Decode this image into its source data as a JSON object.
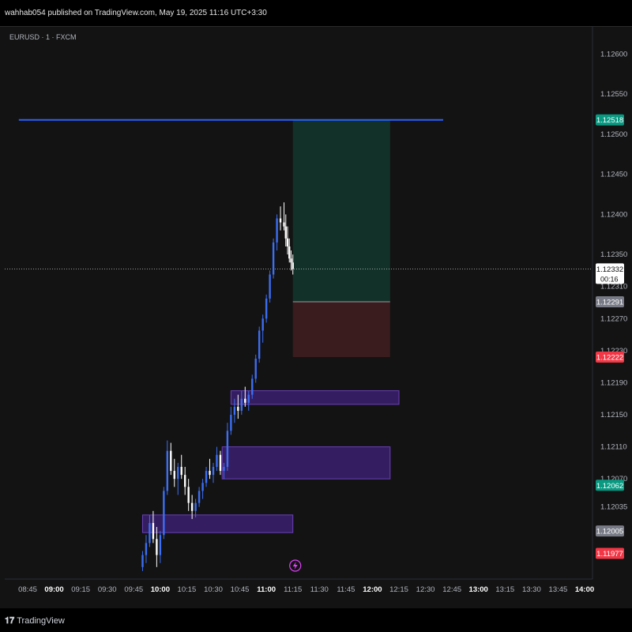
{
  "header": {
    "publish_line": "wahhab054 published on TradingView.com, May 19, 2025 11:16 UTC+3:30"
  },
  "symbol_label": "EURUSD · 1 · FXCM",
  "footer": {
    "brand": "TradingView",
    "logo_glyph": "𝟏𝟕"
  },
  "colors": {
    "background": "#131313",
    "up": "#3d6ef3",
    "down": "#ffffff",
    "blue_line": "#2962ff",
    "profit_zone": "#123229",
    "loss_zone": "#3a1c1f",
    "order_block": "#3b2170",
    "order_block_border": "#6b3fb8"
  },
  "chart_data": {
    "type": "candlestick",
    "symbol": "EURUSD",
    "interval": "1",
    "source": "FXCM",
    "x_ticks": [
      "08:45",
      "09:00",
      "09:15",
      "09:30",
      "09:45",
      "10:00",
      "10:15",
      "10:30",
      "10:45",
      "11:00",
      "11:15",
      "11:30",
      "11:45",
      "12:00",
      "12:15",
      "12:30",
      "12:45",
      "13:00",
      "13:15",
      "13:30",
      "13:45",
      "14:00"
    ],
    "bold_x_ticks": [
      "09:00",
      "10:00",
      "11:00",
      "12:00",
      "13:00",
      "14:00"
    ],
    "y_ticks": [
      "1.12600",
      "1.12550",
      "1.12500",
      "1.12450",
      "1.12400",
      "1.12350",
      "1.12310",
      "1.12270",
      "1.12230",
      "1.12190",
      "1.12150",
      "1.12110",
      "1.12070",
      "1.12035"
    ],
    "ylim": [
      1.11945,
      1.12635
    ],
    "price_labels": [
      {
        "value": "1.12518",
        "bg": "#089981",
        "fg": "#ffffff"
      },
      {
        "value": "1.12332",
        "bg": "#ffffff",
        "fg": "#131313",
        "countdown": "00:16"
      },
      {
        "value": "1.12291",
        "bg": "#787b86",
        "fg": "#ffffff"
      },
      {
        "value": "1.12222",
        "bg": "#f23645",
        "fg": "#ffffff"
      },
      {
        "value": "1.12062",
        "bg": "#089981",
        "fg": "#ffffff"
      },
      {
        "value": "1.12005",
        "bg": "#787b86",
        "fg": "#ffffff"
      },
      {
        "value": "1.11977",
        "bg": "#f23645",
        "fg": "#ffffff"
      }
    ],
    "horizontal_line": {
      "price": 1.12518,
      "from": "08:40",
      "to": "12:40"
    },
    "current_price_line": 1.12332,
    "long_position": {
      "start": "11:15",
      "end": "12:10",
      "target": 1.12518,
      "entry": 1.12291,
      "stop": 1.12222
    },
    "order_blocks": [
      {
        "start": "10:40",
        "end": "12:15",
        "top": 1.1218,
        "bottom": 1.12163
      },
      {
        "start": "10:35",
        "end": "12:10",
        "top": 1.1211,
        "bottom": 1.1207
      },
      {
        "start": "09:50",
        "end": "11:15",
        "top": 1.12025,
        "bottom": 1.12003
      }
    ],
    "ohlc": [
      [
        "09:50",
        1.1196,
        1.1198,
        1.11955,
        1.11975
      ],
      [
        "09:52",
        1.11975,
        1.12,
        1.11965,
        1.1199
      ],
      [
        "09:54",
        1.1199,
        1.12025,
        1.11985,
        1.12015
      ],
      [
        "09:56",
        1.12015,
        1.1203,
        1.1199,
        1.11995
      ],
      [
        "09:58",
        1.11995,
        1.1201,
        1.1196,
        1.11975
      ],
      [
        "10:00",
        1.11975,
        1.12005,
        1.11965,
        1.12
      ],
      [
        "10:02",
        1.12,
        1.1206,
        1.11995,
        1.12055
      ],
      [
        "10:04",
        1.12055,
        1.12118,
        1.1205,
        1.12105
      ],
      [
        "10:06",
        1.12105,
        1.12115,
        1.12075,
        1.1208
      ],
      [
        "10:08",
        1.1208,
        1.12095,
        1.1206,
        1.1207
      ],
      [
        "10:10",
        1.1207,
        1.1209,
        1.1205,
        1.12085
      ],
      [
        "10:12",
        1.12085,
        1.121,
        1.1207,
        1.12075
      ],
      [
        "10:14",
        1.12075,
        1.12085,
        1.1205,
        1.1206
      ],
      [
        "10:16",
        1.1206,
        1.1207,
        1.1203,
        1.1204
      ],
      [
        "10:18",
        1.1204,
        1.1205,
        1.1202,
        1.1203
      ],
      [
        "10:20",
        1.1203,
        1.12045,
        1.12022,
        1.1204
      ],
      [
        "10:22",
        1.1204,
        1.1206,
        1.12035,
        1.12055
      ],
      [
        "10:24",
        1.12055,
        1.1207,
        1.12045,
        1.12065
      ],
      [
        "10:26",
        1.12065,
        1.12085,
        1.1206,
        1.1208
      ],
      [
        "10:28",
        1.1208,
        1.12095,
        1.1207,
        1.12075
      ],
      [
        "10:30",
        1.12075,
        1.1209,
        1.12065,
        1.12085
      ],
      [
        "10:32",
        1.12085,
        1.1211,
        1.1208,
        1.121
      ],
      [
        "10:34",
        1.121,
        1.12105,
        1.12075,
        1.1208
      ],
      [
        "10:36",
        1.1208,
        1.1209,
        1.1207,
        1.12085
      ],
      [
        "10:38",
        1.12085,
        1.1214,
        1.1208,
        1.1213
      ],
      [
        "10:40",
        1.1213,
        1.1216,
        1.12125,
        1.1215
      ],
      [
        "10:42",
        1.1215,
        1.1217,
        1.1214,
        1.1216
      ],
      [
        "10:44",
        1.1216,
        1.12175,
        1.12145,
        1.12155
      ],
      [
        "10:46",
        1.12155,
        1.1218,
        1.1215,
        1.1217
      ],
      [
        "10:48",
        1.1217,
        1.12185,
        1.1216,
        1.12165
      ],
      [
        "10:50",
        1.12165,
        1.1218,
        1.12155,
        1.12175
      ],
      [
        "10:52",
        1.12175,
        1.122,
        1.1217,
        1.12195
      ],
      [
        "10:54",
        1.12195,
        1.12225,
        1.1219,
        1.1222
      ],
      [
        "10:56",
        1.1222,
        1.1226,
        1.12215,
        1.12255
      ],
      [
        "10:58",
        1.12255,
        1.12275,
        1.1224,
        1.1227
      ],
      [
        "11:00",
        1.1227,
        1.123,
        1.12265,
        1.12295
      ],
      [
        "11:02",
        1.12295,
        1.1233,
        1.1229,
        1.12325
      ],
      [
        "11:04",
        1.12325,
        1.1237,
        1.1232,
        1.12365
      ],
      [
        "11:06",
        1.12365,
        1.124,
        1.12355,
        1.12395
      ],
      [
        "11:08",
        1.12395,
        1.1241,
        1.1238,
        1.1239
      ],
      [
        "11:10",
        1.1239,
        1.12415,
        1.1238,
        1.12385
      ],
      [
        "11:11",
        1.12385,
        1.124,
        1.1236,
        1.1237
      ],
      [
        "11:12",
        1.1237,
        1.12385,
        1.1235,
        1.1236
      ],
      [
        "11:13",
        1.1236,
        1.1237,
        1.1234,
        1.12345
      ],
      [
        "11:14",
        1.12345,
        1.12355,
        1.1233,
        1.1234
      ],
      [
        "11:15",
        1.1234,
        1.1235,
        1.12325,
        1.12332
      ]
    ]
  }
}
